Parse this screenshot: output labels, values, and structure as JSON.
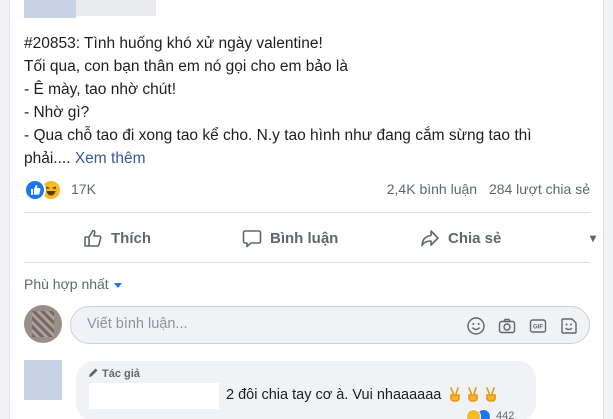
{
  "post": {
    "lines": [
      "#20853: Tình huống khó xử ngày valentine!",
      "Tối qua, con bạn thân em nó gọi cho em bảo là",
      "- Ê mày, tao nhờ chút!",
      "- Nhờ gì?",
      "- Qua chỗ tao đi xong tao kể cho. N.y tao hình như đang cắm sừng tao thì",
      "phải...."
    ],
    "see_more": "Xem thêm"
  },
  "stats": {
    "reaction_count": "17K",
    "comments": "2,4K bình luận",
    "shares": "284 lượt chia sẻ"
  },
  "actions": {
    "like": "Thích",
    "comment": "Bình luận",
    "share": "Chia sẻ"
  },
  "sort": {
    "label": "Phù hợp nhất"
  },
  "comment_input": {
    "placeholder": "Viết bình luận..."
  },
  "reply": {
    "badge": "Tác giả",
    "text": "2 đôi chia tay cơ à. Vui nhaaaaaa",
    "reaction_count": "442"
  },
  "colors": {
    "link": "#385898",
    "accent": "#1877f2",
    "haha": "#f7b928"
  }
}
